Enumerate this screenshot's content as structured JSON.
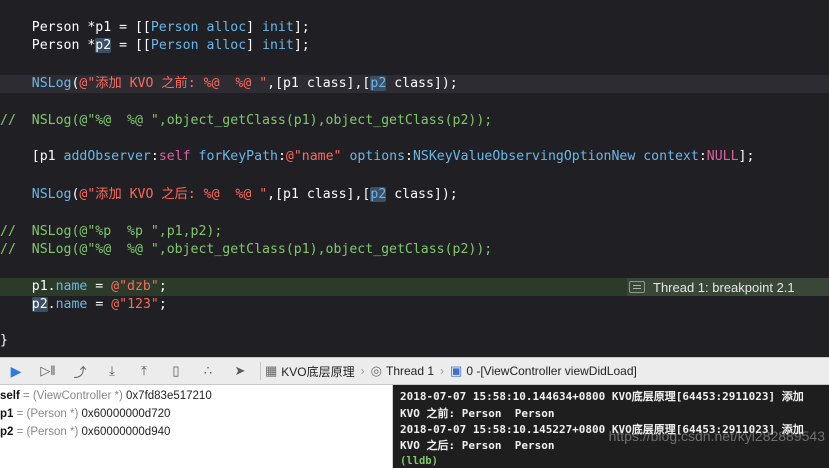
{
  "editor": {
    "lines": {
      "l1": {
        "a": "    Person *p1 = [[",
        "b": "Person",
        "c": " ",
        "d": "alloc",
        "e": "] ",
        "f": "init",
        "g": "];"
      },
      "l2": {
        "a": "    Person *",
        "sel": "p2",
        "b": " = [[",
        "c": "Person",
        "d": " ",
        "e": "alloc",
        "f": "] ",
        "g": "init",
        "h": "];"
      },
      "l3": {
        "a": "    ",
        "fn": "NSLog",
        "b": "(",
        "str": "@\"添加 KVO 之前: %@  %@ \"",
        "c": ",[p1 class],[",
        "sel": "p2",
        "d": " class]);"
      },
      "l4": {
        "text": "//  NSLog(@\"%@  %@ \",object_getClass(p1),object_getClass(p2));"
      },
      "l5": {
        "a": "    [p1 ",
        "m1": "addObserver",
        "b": ":",
        "self": "self",
        "c": " ",
        "m2": "forKeyPath",
        "d": ":",
        "str": "@\"name\"",
        "e": " ",
        "m3": "options",
        "f": ":",
        "opt": "NSKeyValueObservingOptionNew",
        "g": " ",
        "m4": "context",
        "h": ":",
        "null": "NULL",
        "i": "];"
      },
      "l6": {
        "a": "    ",
        "fn": "NSLog",
        "b": "(",
        "str": "@\"添加 KVO 之后: %@  %@ \"",
        "c": ",[p1 class],[",
        "sel": "p2",
        "d": " class]);"
      },
      "l7": {
        "text": "//  NSLog(@\"%p  %p \",p1,p2);"
      },
      "l8": {
        "text": "//  NSLog(@\"%@  %@ \",object_getClass(p1),object_getClass(p2));"
      },
      "l9": {
        "a": "    p1.",
        "prop": "name",
        "b": " = ",
        "str": "@\"dzb\"",
        "c": ";"
      },
      "l10": {
        "a": "    ",
        "sel": "p2",
        "b": ".",
        "prop": "name",
        "c": " = ",
        "str": "@\"123\"",
        "d": ";"
      },
      "l11": {
        "text": "}"
      }
    },
    "breakpoint_label": "Thread 1: breakpoint 2.1"
  },
  "toolbar": {
    "crumbs": {
      "target": "KVO底层原理",
      "thread": "Thread 1",
      "frame": "0 -[ViewController viewDidLoad]"
    }
  },
  "variables": [
    {
      "name": "self",
      "type": " = (ViewController *) ",
      "value": "0x7fd83e517210"
    },
    {
      "name": "p1",
      "type": " = (Person *) ",
      "value": "0x60000000d720"
    },
    {
      "name": "p2",
      "type": " = (Person *) ",
      "value": "0x60000000d940"
    }
  ],
  "console": {
    "lines": [
      "2018-07-07 15:58:10.144634+0800 KVO底层原理[64453:2911023] 添加",
      "KVO 之前: Person  Person",
      "2018-07-07 15:58:10.145227+0800 KVO底层原理[64453:2911023] 添加",
      "KVO 之后: Person  Person"
    ],
    "prompt": "(lldb)"
  },
  "watermark": "https://blog.csdn.net/kyl282889543",
  "colors": {
    "editor_bg": "#1f1f24",
    "keyword_blue": "#6bb8e8",
    "string_red": "#fc6a5d",
    "comment_green": "#82c86b",
    "macro_purple": "#d8649f",
    "breakpoint_line": "#2c3a2a"
  },
  "icons": {
    "toolbar": [
      "breakpoint-toggle-icon",
      "continue-icon",
      "step-over-icon",
      "step-into-icon",
      "step-out-icon",
      "debug-view-hierarchy-icon",
      "memory-graph-icon",
      "location-icon",
      "scheme-icon",
      "thread-icon",
      "frame-icon"
    ]
  }
}
